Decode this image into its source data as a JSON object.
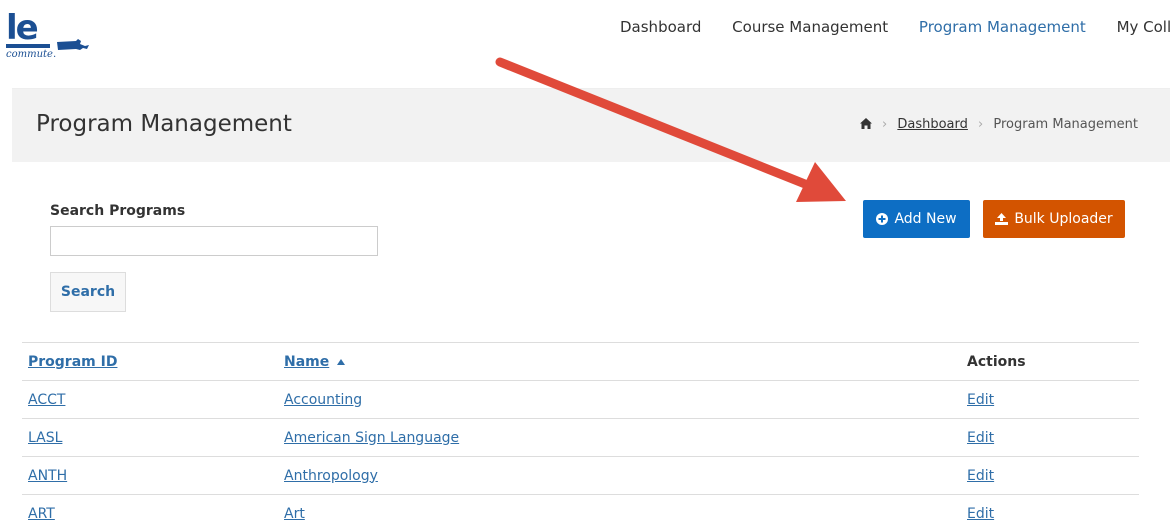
{
  "header": {
    "logo": {
      "mark": "le",
      "tagline": "commute.",
      "state_shape": "massachusetts-icon"
    },
    "nav": [
      {
        "label": "Dashboard",
        "active": false
      },
      {
        "label": "Course Management",
        "active": false
      },
      {
        "label": "Program Management",
        "active": true
      },
      {
        "label": "My College",
        "active": false
      }
    ]
  },
  "page": {
    "title": "Program Management",
    "breadcrumb": {
      "home_icon": "home-icon",
      "items": [
        "Dashboard",
        "Program Management"
      ]
    }
  },
  "search": {
    "label": "Search Programs",
    "value": "",
    "placeholder": "",
    "button_label": "Search"
  },
  "actions": {
    "add_new": {
      "label": "Add New",
      "icon": "plus-circle-icon",
      "color": "#0d6ec4"
    },
    "bulk_uploader": {
      "label": "Bulk Uploader",
      "icon": "upload-icon",
      "color": "#d35400"
    }
  },
  "table": {
    "columns": [
      "Program ID",
      "Name",
      "Actions"
    ],
    "sort": {
      "column": "Name",
      "direction": "ascending"
    },
    "rows": [
      {
        "id": "ACCT",
        "name": "Accounting",
        "action": "Edit"
      },
      {
        "id": "LASL",
        "name": "American Sign Language",
        "action": "Edit"
      },
      {
        "id": "ANTH",
        "name": "Anthropology",
        "action": "Edit"
      },
      {
        "id": "ART",
        "name": "Art",
        "action": "Edit"
      }
    ]
  },
  "annotation": {
    "type": "arrow",
    "color": "#e04a3a",
    "points_to": "Add New"
  }
}
